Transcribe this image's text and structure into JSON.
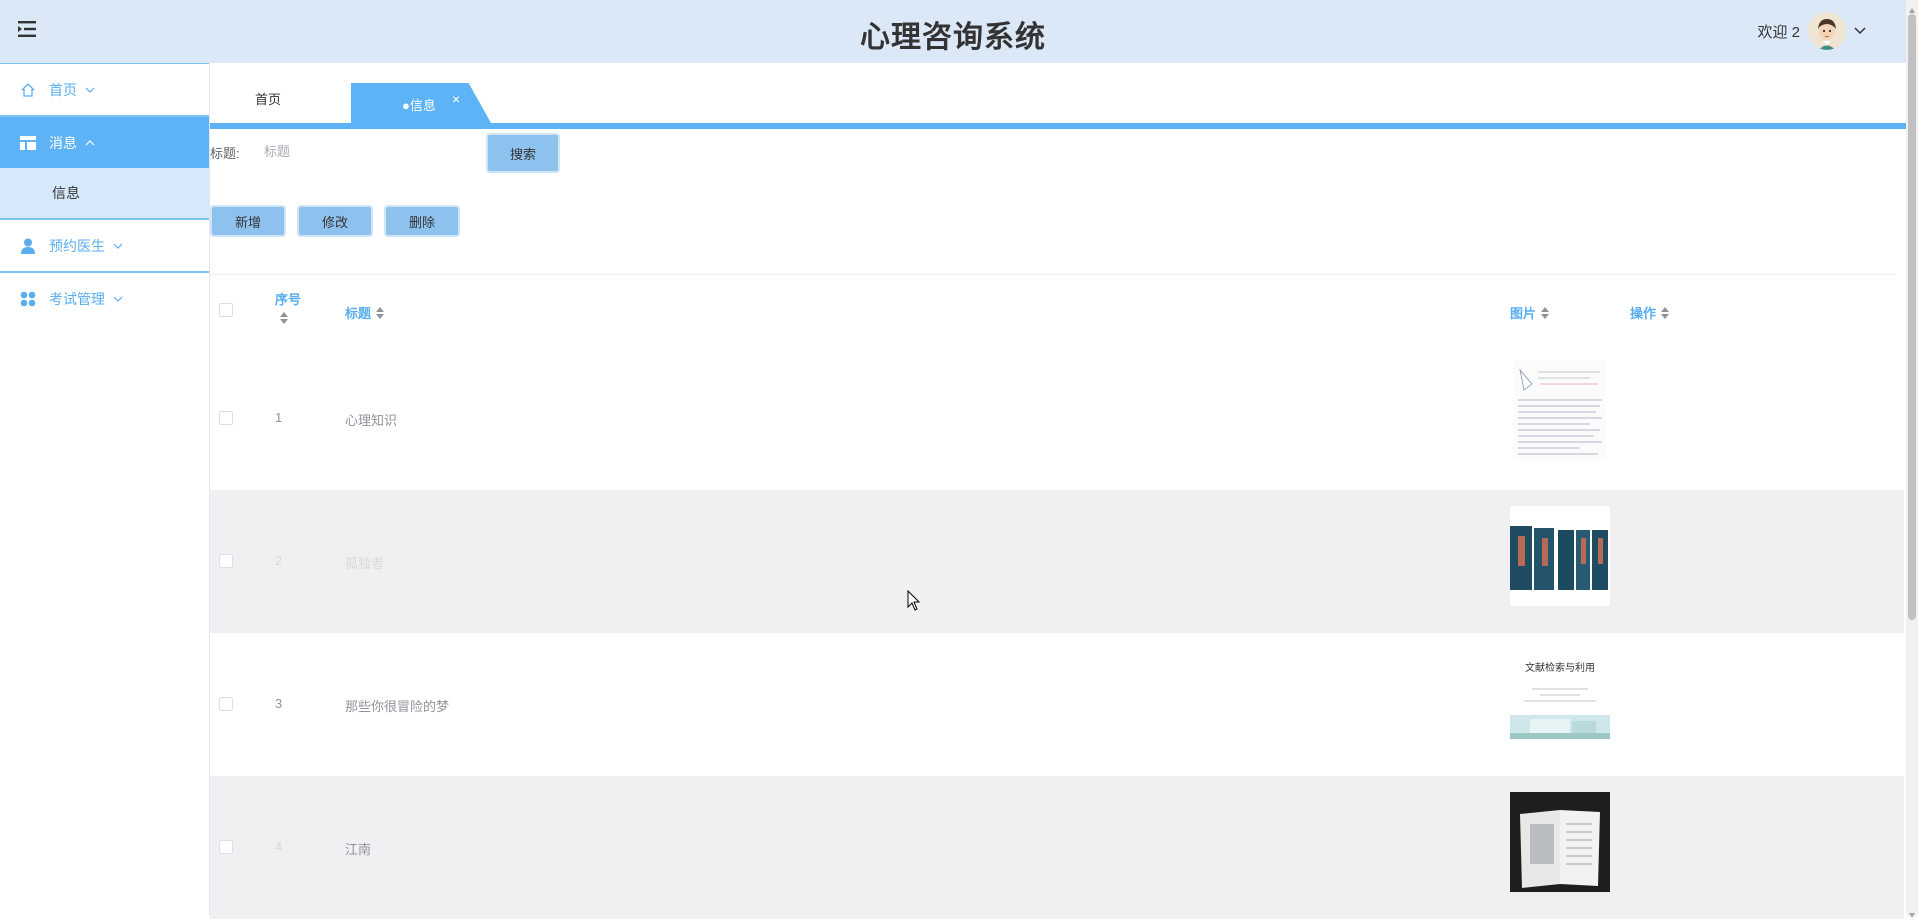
{
  "header": {
    "title": "心理咨询系统",
    "welcome": "欢迎 2",
    "menu_toggle_icon": "menu-fold-icon",
    "user_menu_icon": "chevron-down-icon"
  },
  "sidebar": {
    "items": [
      {
        "label": "首页",
        "icon": "home-icon",
        "expanded": false
      },
      {
        "label": "消息",
        "icon": "layout-icon",
        "expanded": true,
        "children": [
          {
            "label": "信息"
          }
        ]
      },
      {
        "label": "预约医生",
        "icon": "user-icon",
        "expanded": false
      },
      {
        "label": "考试管理",
        "icon": "grid-icon",
        "expanded": false
      }
    ]
  },
  "tabs": {
    "home": "首页",
    "active": "●信息",
    "close": "×"
  },
  "search": {
    "label": "标题:",
    "placeholder": "标题",
    "value": "",
    "button": "搜索"
  },
  "actions": {
    "add": "新增",
    "edit": "修改",
    "delete": "删除"
  },
  "table": {
    "columns": {
      "index": "序号",
      "title": "标题",
      "image": "图片",
      "operation": "操作"
    },
    "rows": [
      {
        "index": "1",
        "title": "心理知识",
        "image": "handwritten-notes-thumbnail"
      },
      {
        "index": "2",
        "title": "孤独者",
        "image": "book-volumes-thumbnail"
      },
      {
        "index": "3",
        "title": "那些你很冒险的梦",
        "image": "document-cover-thumbnail"
      },
      {
        "index": "4",
        "title": "江南",
        "image": "open-book-thumbnail"
      }
    ],
    "thumb_text": {
      "row3_heading": "文献检索与利用"
    }
  },
  "colors": {
    "header_bg": "#dbe8f7",
    "accent": "#5db3f5",
    "sidebar_link": "#5aaef0",
    "button_bg": "#8ec2ee",
    "row_alt": "#f0f0f2"
  }
}
